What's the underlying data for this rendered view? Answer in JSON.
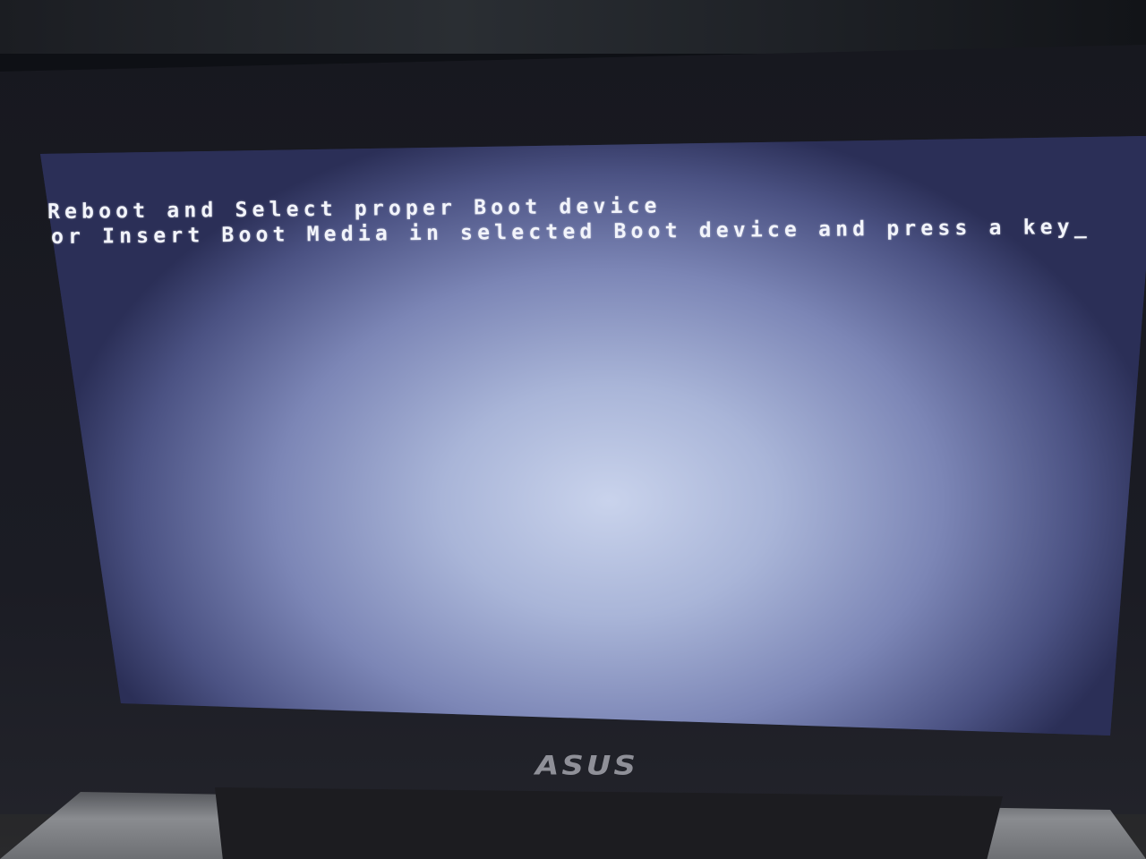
{
  "boot_screen": {
    "line1": "Reboot and Select proper Boot device",
    "line2": "or Insert Boot Media in selected Boot device and press a key",
    "cursor": "_"
  },
  "laptop": {
    "brand_logo": "ASUS"
  },
  "colors": {
    "screen_text": "#f2f4fb",
    "screen_bg": "#a9b5d8",
    "bezel": "#17181f"
  }
}
